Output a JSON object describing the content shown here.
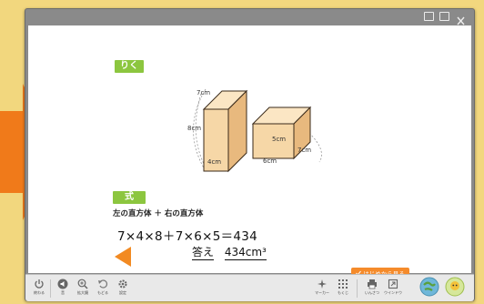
{
  "colors": {
    "background": "#f2d77e",
    "arrow": "#f07a1a",
    "tag_green": "#8cc63f",
    "box_fill": "#f6d7a7",
    "box_side": "#e3b47a",
    "button_orange": "#f58b2b"
  },
  "window": {
    "controls": [
      "fullscreen-icon",
      "restore-icon",
      "close-icon"
    ]
  },
  "problem": {
    "title_tag": "りく",
    "boxes": {
      "left": {
        "height": "8cm",
        "depth": "7cm",
        "width": "4cm"
      },
      "right": {
        "height": "5cm",
        "width": "6cm",
        "depth": "7cm"
      }
    },
    "formula_tag": "式",
    "description": "左の直方体 ＋ 右の直方体",
    "expression": "7×4×8＋7×6×5＝434",
    "answer_label": "答え",
    "answer_value": "434cm³",
    "restart_label": "はじめから見る"
  },
  "toolbar": {
    "left": [
      {
        "icon": "power-icon",
        "label": "終わる"
      },
      {
        "icon": "speaker-icon",
        "label": "音"
      },
      {
        "icon": "zoom-in-icon",
        "label": "拡大鏡"
      },
      {
        "icon": "undo-icon",
        "label": "もどる"
      },
      {
        "icon": "settings-icon",
        "label": "設定"
      }
    ],
    "right": [
      {
        "icon": "marker-icon",
        "label": "マーカー"
      },
      {
        "icon": "grid-icon",
        "label": "もくじ"
      },
      {
        "icon": "print-icon",
        "label": "いんさつ"
      },
      {
        "icon": "window-icon",
        "label": "ウインドウ"
      },
      {
        "icon": "globe-icon",
        "label": ""
      },
      {
        "icon": "character-icon",
        "label": ""
      }
    ]
  }
}
